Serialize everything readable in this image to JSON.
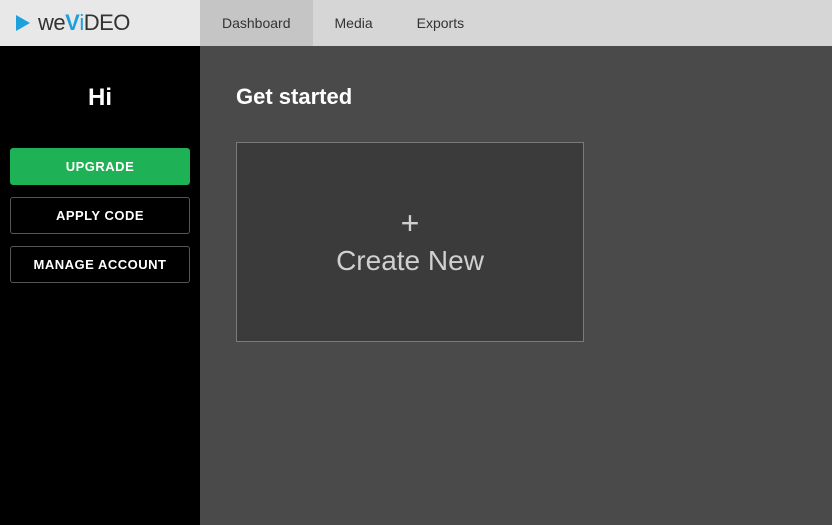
{
  "logo": {
    "part1": "we",
    "part2": "V",
    "part3": "i",
    "part4": "DEO"
  },
  "nav": {
    "tabs": [
      {
        "label": "Dashboard",
        "active": true
      },
      {
        "label": "Media",
        "active": false
      },
      {
        "label": "Exports",
        "active": false
      }
    ]
  },
  "sidebar": {
    "greeting": "Hi",
    "upgrade_label": "UPGRADE",
    "apply_code_label": "APPLY CODE",
    "manage_account_label": "MANAGE ACCOUNT"
  },
  "main": {
    "heading": "Get started",
    "create_card": {
      "plus": "+",
      "label": "Create New"
    }
  },
  "colors": {
    "accent": "#1da1dc",
    "upgrade": "#1fb155",
    "bg_dark": "#4a4a4a"
  }
}
